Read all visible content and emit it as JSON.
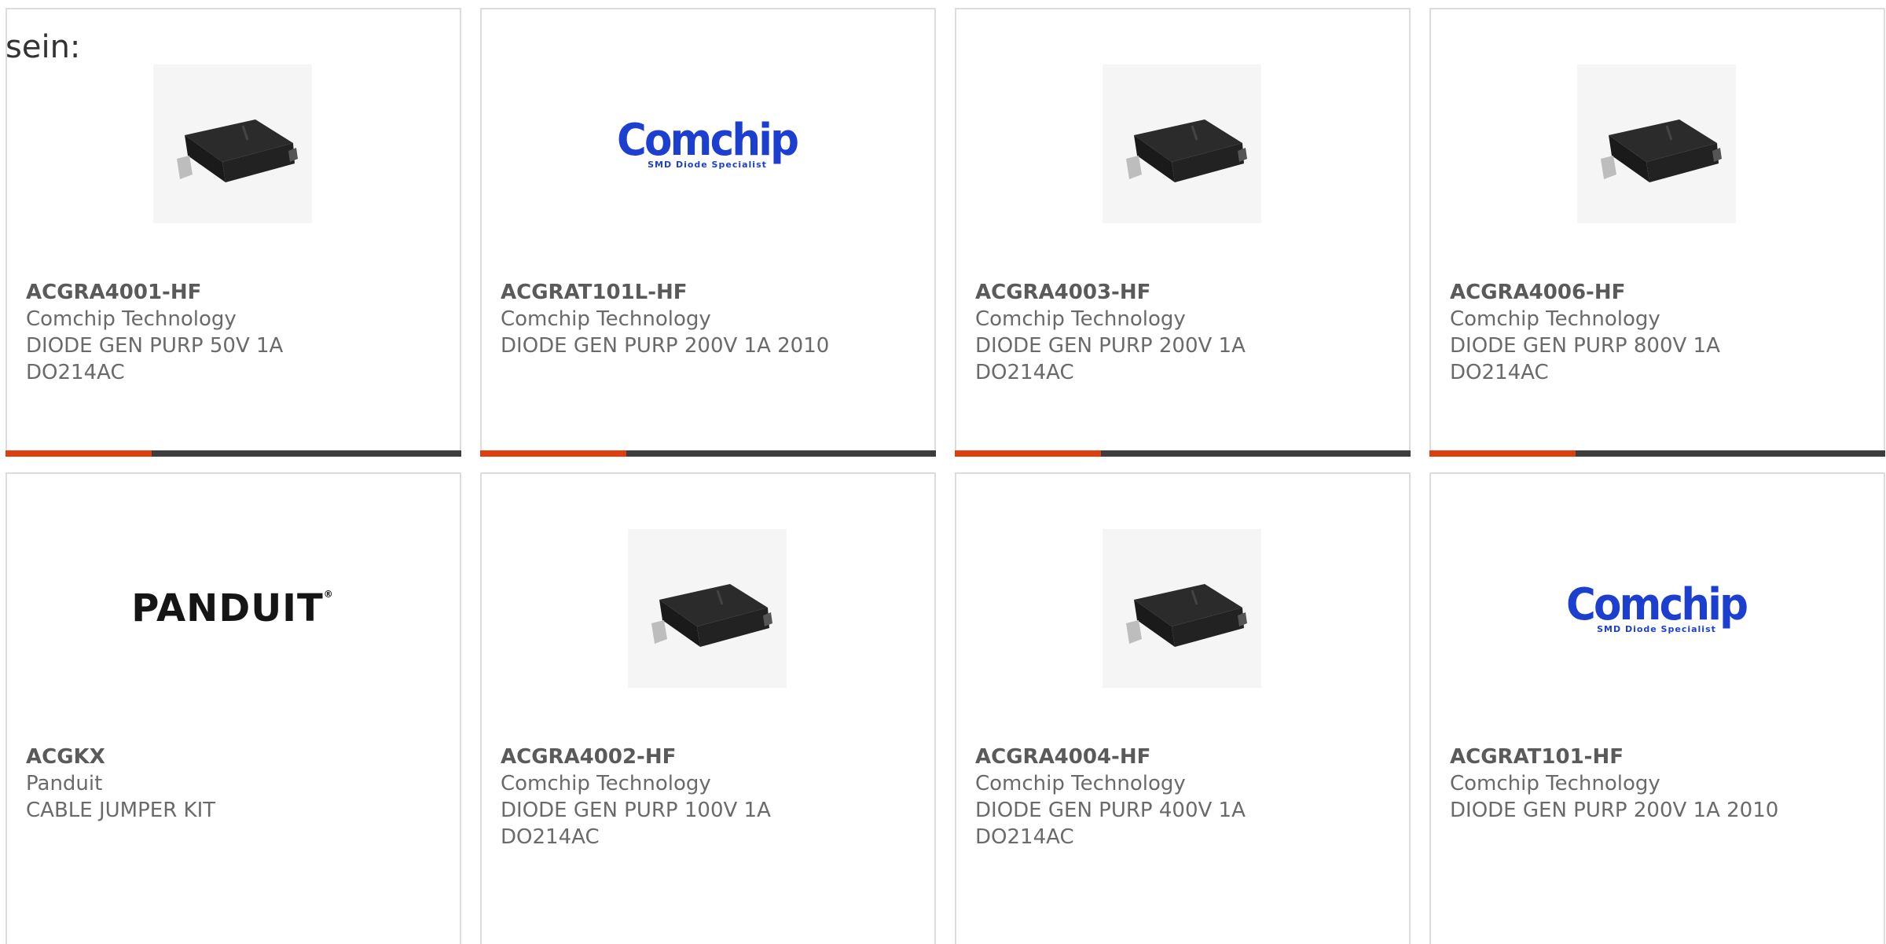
{
  "intro_text": "sein:",
  "products": [
    {
      "part_number": "ACGRA4001-HF",
      "manufacturer": "Comchip Technology",
      "description_line1": "DIODE GEN PURP 50V 1A",
      "description_line2": "DO214AC",
      "image": "smd-diode-photo",
      "progress": 0.32
    },
    {
      "part_number": "ACGRAT101L-HF",
      "manufacturer": "Comchip Technology",
      "description_line1": "DIODE GEN PURP 200V 1A 2010",
      "description_line2": "",
      "image": "comchip-logo",
      "logo_word": "Comchip",
      "logo_tagline": "SMD Diode Specialist",
      "progress": 0.32
    },
    {
      "part_number": "ACGRA4003-HF",
      "manufacturer": "Comchip Technology",
      "description_line1": "DIODE GEN PURP 200V 1A",
      "description_line2": "DO214AC",
      "image": "smd-diode-photo",
      "progress": 0.32
    },
    {
      "part_number": "ACGRA4006-HF",
      "manufacturer": "Comchip Technology",
      "description_line1": "DIODE GEN PURP 800V 1A",
      "description_line2": "DO214AC",
      "image": "smd-diode-photo",
      "progress": 0.32
    },
    {
      "part_number": "ACGKX",
      "manufacturer": "Panduit",
      "description_line1": "CABLE JUMPER KIT",
      "description_line2": "",
      "image": "panduit-logo",
      "logo_word": "PANDUIT"
    },
    {
      "part_number": "ACGRA4002-HF",
      "manufacturer": "Comchip Technology",
      "description_line1": "DIODE GEN PURP 100V 1A",
      "description_line2": "DO214AC",
      "image": "smd-diode-photo"
    },
    {
      "part_number": "ACGRA4004-HF",
      "manufacturer": "Comchip Technology",
      "description_line1": "DIODE GEN PURP 400V 1A",
      "description_line2": "DO214AC",
      "image": "smd-diode-photo"
    },
    {
      "part_number": "ACGRAT101-HF",
      "manufacturer": "Comchip Technology",
      "description_line1": "DIODE GEN PURP 200V 1A 2010",
      "description_line2": "",
      "image": "comchip-logo",
      "logo_word": "Comchip",
      "logo_tagline": "SMD Diode Specialist"
    }
  ],
  "colors": {
    "accent": "#e03e0f",
    "bar_track": "#3d3d3d",
    "card_border": "#dcdcdc",
    "text": "#6a6a6a",
    "comchip_blue": "#1c3fd0"
  }
}
